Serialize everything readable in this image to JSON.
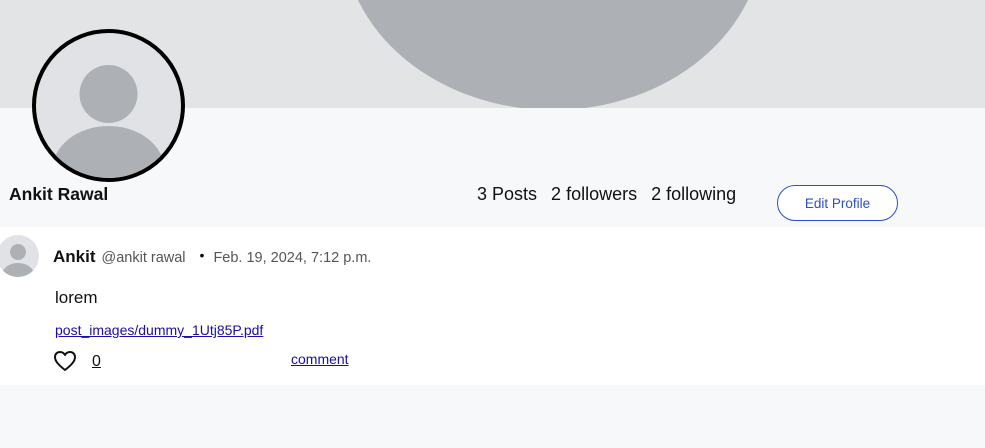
{
  "profile": {
    "name": "Ankit Rawal",
    "stats": [
      {
        "count": "3",
        "label": "Posts"
      },
      {
        "count": "2",
        "label": "followers"
      },
      {
        "count": "2",
        "label": "following"
      }
    ],
    "edit_label": "Edit Profile"
  },
  "post": {
    "author": "Ankit",
    "handle": "@ankit rawal",
    "separator": "•",
    "date": "Feb. 19, 2024, 7:12 p.m.",
    "body": "lorem",
    "file_link": "post_images/dummy_1Utj85P.pdf",
    "like_count": "0",
    "comment_label": "comment",
    "like_icon": "heart-outline-icon"
  },
  "colors": {
    "page_bg": "#f7f8fa",
    "cover_bg": "#e2e4e6",
    "cover_shape": "#adb1b5",
    "accent": "#2a4fc8",
    "link": "#1a0dab"
  }
}
